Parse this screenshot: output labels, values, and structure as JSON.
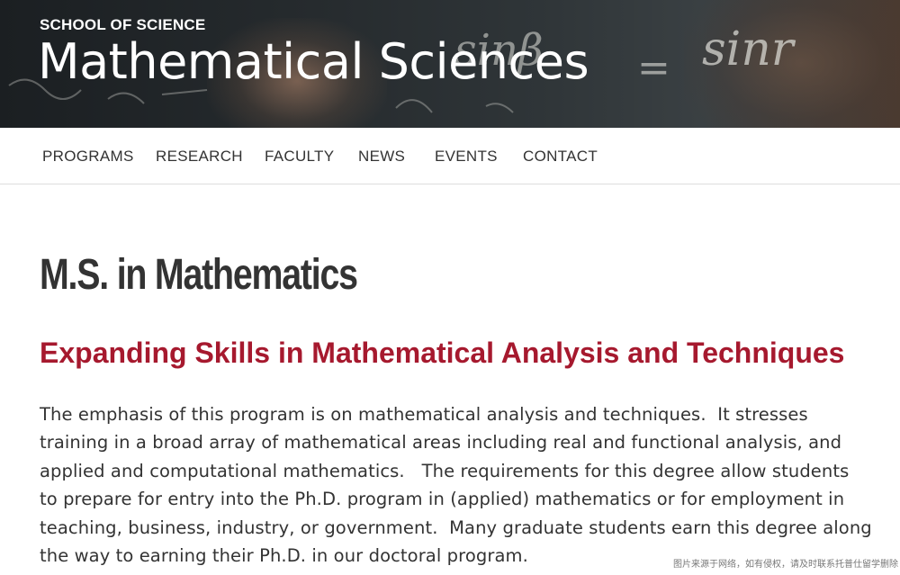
{
  "header": {
    "school_label": "SCHOOL OF SCIENCE",
    "title": "Mathematical Sciences",
    "chalk_text": [
      "sinβ",
      "=",
      "sinr"
    ]
  },
  "nav": {
    "items": [
      {
        "label": "PROGRAMS"
      },
      {
        "label": "RESEARCH"
      },
      {
        "label": "FACULTY"
      },
      {
        "label": "NEWS"
      },
      {
        "label": "EVENTS"
      },
      {
        "label": "CONTACT"
      }
    ]
  },
  "main": {
    "page_title": "M.S. in Mathematics",
    "subtitle": "Expanding Skills in Mathematical Analysis and Techniques",
    "body": "The emphasis of this program is on mathematical analysis and techniques.  It stresses training in a broad array of mathematical areas including real and functional analysis, and applied and computational mathematics.   The requirements for this degree allow students to prepare for entry into the Ph.D. program in (applied) mathematics or for employment in teaching, business, industry, or government.  Many graduate students earn this degree along the way to earning their Ph.D. in our doctoral program."
  },
  "watermark": "图片来源于网络，如有侵权，请及时联系托普仕留学删除",
  "colors": {
    "banner_dark": "#1b1f22",
    "accent_red": "#a6192e",
    "text": "#333333"
  }
}
